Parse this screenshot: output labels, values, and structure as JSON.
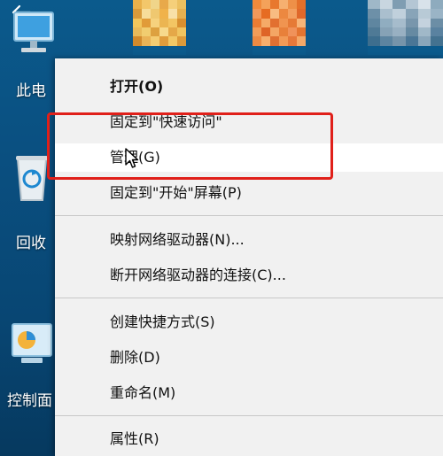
{
  "desktop": {
    "icons": [
      {
        "label": "此电",
        "icon": "computer-icon"
      },
      {
        "label": "回收",
        "icon": "recycle-bin-icon"
      },
      {
        "label": "控制面",
        "icon": "control-panel-icon"
      }
    ]
  },
  "context_menu": {
    "items": [
      {
        "label": "打开(O)",
        "bold": true
      },
      {
        "label": "固定到\"快速访问\""
      },
      {
        "label": "管理(G)",
        "highlighted": true
      },
      {
        "label": "固定到\"开始\"屏幕(P)"
      },
      {
        "label": "映射网络驱动器(N)..."
      },
      {
        "label": "断开网络驱动器的连接(C)..."
      },
      {
        "label": "创建快捷方式(S)"
      },
      {
        "label": "删除(D)"
      },
      {
        "label": "重命名(M)"
      },
      {
        "label": "属性(R)"
      }
    ]
  },
  "annotation": {
    "color": "#e0201a",
    "target": "管理(G)"
  },
  "icons": [
    "back-arrow-icon",
    "cursor-icon"
  ]
}
